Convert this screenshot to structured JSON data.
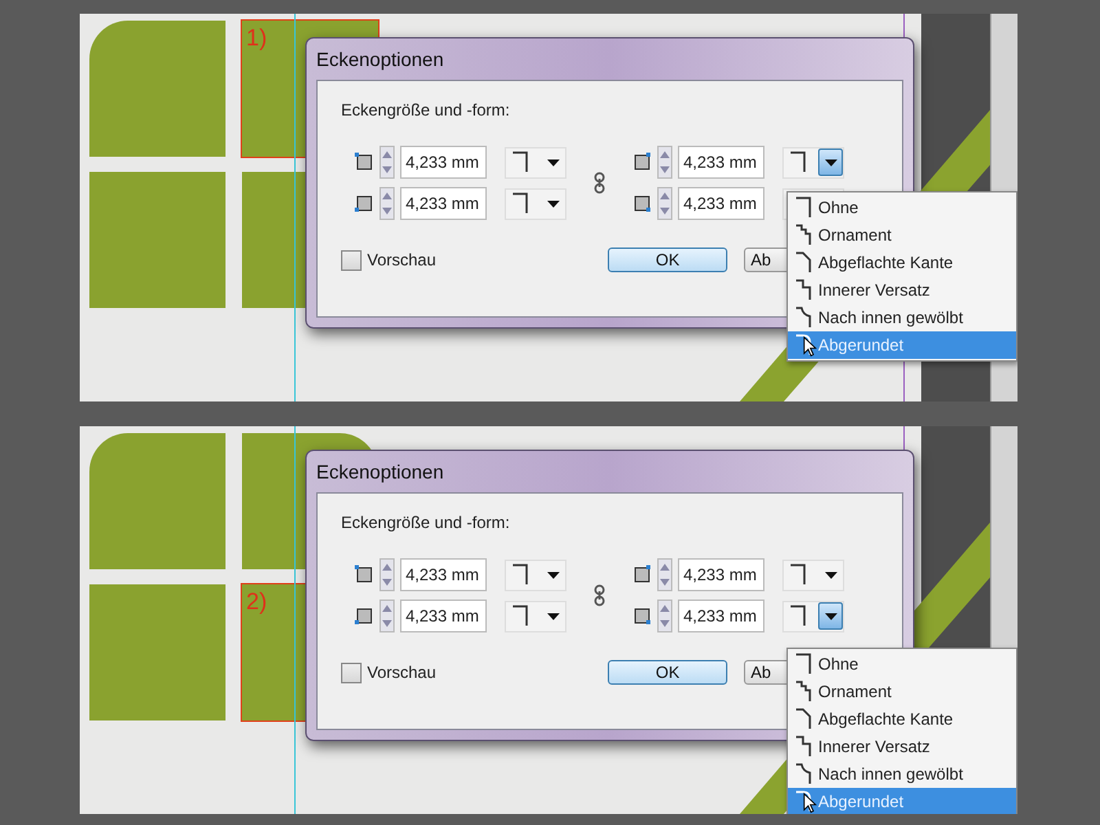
{
  "panels": [
    {
      "marker": "1)",
      "tiles": [
        {
          "kind": "round-top-left",
          "selected": false
        },
        {
          "kind": "square",
          "selected": true
        },
        {
          "kind": "square",
          "selected": false
        },
        {
          "kind": "square",
          "selected": false
        }
      ],
      "dialog": {
        "title": "Eckenoptionen",
        "section_label": "Eckengröße und -form:",
        "corners": [
          {
            "value": "4,233 mm",
            "open": false
          },
          {
            "value": "4,233 mm",
            "open": true
          },
          {
            "value": "4,233 mm",
            "open": false
          },
          {
            "value": "4,233 mm",
            "open": false
          }
        ],
        "preview": {
          "label": "Vorschau",
          "checked": false
        },
        "buttons": [
          "OK",
          "Ab"
        ]
      },
      "menu": {
        "options": [
          {
            "kind": "none",
            "label": "Ohne",
            "selected": false
          },
          {
            "kind": "fancy",
            "label": "Ornament",
            "selected": false
          },
          {
            "kind": "bevel",
            "label": "Abgeflachte Kante",
            "selected": false
          },
          {
            "kind": "inset",
            "label": "Innerer Versatz",
            "selected": false
          },
          {
            "kind": "inverse",
            "label": "Nach innen gewölbt",
            "selected": false
          },
          {
            "kind": "rounded",
            "label": "Abgerundet",
            "selected": true
          }
        ]
      }
    },
    {
      "marker": "2)",
      "tiles": [
        {
          "kind": "round-top-left",
          "selected": false
        },
        {
          "kind": "round-top-right",
          "selected": false
        },
        {
          "kind": "square",
          "selected": false
        },
        {
          "kind": "square",
          "selected": true
        }
      ],
      "dialog": {
        "title": "Eckenoptionen",
        "section_label": "Eckengröße und -form:",
        "corners": [
          {
            "value": "4,233 mm",
            "open": false
          },
          {
            "value": "4,233 mm",
            "open": false
          },
          {
            "value": "4,233 mm",
            "open": false
          },
          {
            "value": "4,233 mm",
            "open": true
          }
        ],
        "preview": {
          "label": "Vorschau",
          "checked": false
        },
        "buttons": [
          "OK",
          "Ab"
        ]
      },
      "menu": {
        "options": [
          {
            "kind": "none",
            "label": "Ohne",
            "selected": false
          },
          {
            "kind": "fancy",
            "label": "Ornament",
            "selected": false
          },
          {
            "kind": "bevel",
            "label": "Abgeflachte Kante",
            "selected": false
          },
          {
            "kind": "inset",
            "label": "Innerer Versatz",
            "selected": false
          },
          {
            "kind": "inverse",
            "label": "Nach innen gewölbt",
            "selected": false
          },
          {
            "kind": "rounded",
            "label": "Abgerundet",
            "selected": true
          }
        ]
      }
    }
  ]
}
